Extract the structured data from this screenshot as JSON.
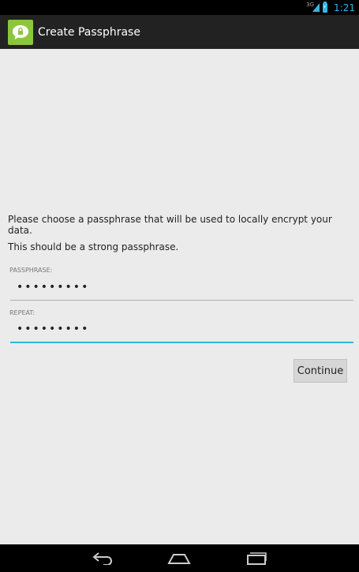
{
  "status_bar": {
    "network": "3G",
    "time": "1:21"
  },
  "action_bar": {
    "title": "Create Passphrase"
  },
  "main": {
    "intro_text": "Please choose a passphrase that will be used to locally encrypt your data.",
    "strong_text": "This should be a strong passphrase.",
    "passphrase_label": "PASSPHRASE:",
    "passphrase_value": "•••••••••",
    "repeat_label": "REPEAT:",
    "repeat_value": "•••••••••",
    "continue_label": "Continue"
  },
  "colors": {
    "accent": "#33b5e5",
    "app_icon": "#8cc63e",
    "action_bar": "#222222",
    "background": "#ebebeb"
  }
}
